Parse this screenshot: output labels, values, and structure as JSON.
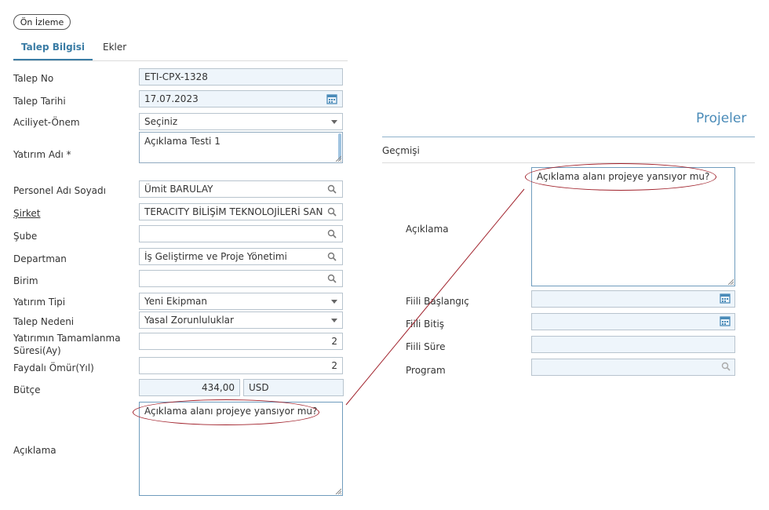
{
  "preview_button": "Ön İzleme",
  "tabs": [
    {
      "label": "Talep Bilgisi",
      "active": true
    },
    {
      "label": "Ekler",
      "active": false
    }
  ],
  "form": {
    "talep_no": {
      "label": "Talep No",
      "value": "ETI-CPX-1328"
    },
    "talep_tarihi": {
      "label": "Talep Tarihi",
      "value": "17.07.2023"
    },
    "aciliyet": {
      "label": "Aciliyet-Önem",
      "value": "Seçiniz"
    },
    "yatirim_adi": {
      "label": "Yatırım Adı *",
      "value": "Açıklama Testi 1"
    },
    "personel": {
      "label": "Personel Adı Soyadı",
      "value": "Ümit BARULAY"
    },
    "sirket": {
      "label": "Şirket",
      "value": "TERACITY BİLİŞİM TEKNOLOJİLERİ SAN. TİC."
    },
    "sube": {
      "label": "Şube",
      "value": ""
    },
    "departman": {
      "label": "Departman",
      "value": "İş Geliştirme ve Proje Yönetimi"
    },
    "birim": {
      "label": "Birim",
      "value": ""
    },
    "yatirim_tipi": {
      "label": "Yatırım Tipi",
      "value": "Yeni Ekipman"
    },
    "talep_nedeni": {
      "label": "Talep Nedeni",
      "value": "Yasal Zorunluluklar"
    },
    "tamamlanma": {
      "label_line1": "Yatırımın Tamamlanma",
      "label_line2": "Süresi(Ay)",
      "value": "2"
    },
    "faydali_omur": {
      "label": "Faydalı Ömür(Yıl)",
      "value": "2"
    },
    "butce": {
      "label": "Bütçe",
      "value": "434,00",
      "currency": "USD"
    },
    "aciklama": {
      "label": "Açıklama",
      "value": "Açıklama alanı projeye yansıyor mu?"
    }
  },
  "projects_panel": {
    "title": "Projeler",
    "tab_label": "Geçmişi",
    "aciklama": {
      "label": "Açıklama",
      "value": "Açıklama alanı projeye yansıyor mu?"
    },
    "fiili_baslangic": {
      "label": "Fiili Başlangıç",
      "value": ""
    },
    "fiili_bitis": {
      "label": "Fiili Bitiş",
      "value": ""
    },
    "fiili_sure": {
      "label": "Fiili Süre",
      "value": ""
    },
    "program": {
      "label": "Program",
      "value": ""
    }
  },
  "colors": {
    "accent": "#3a7ca5",
    "annotation": "#a0202a",
    "readonly_bg": "#eef5fb"
  }
}
